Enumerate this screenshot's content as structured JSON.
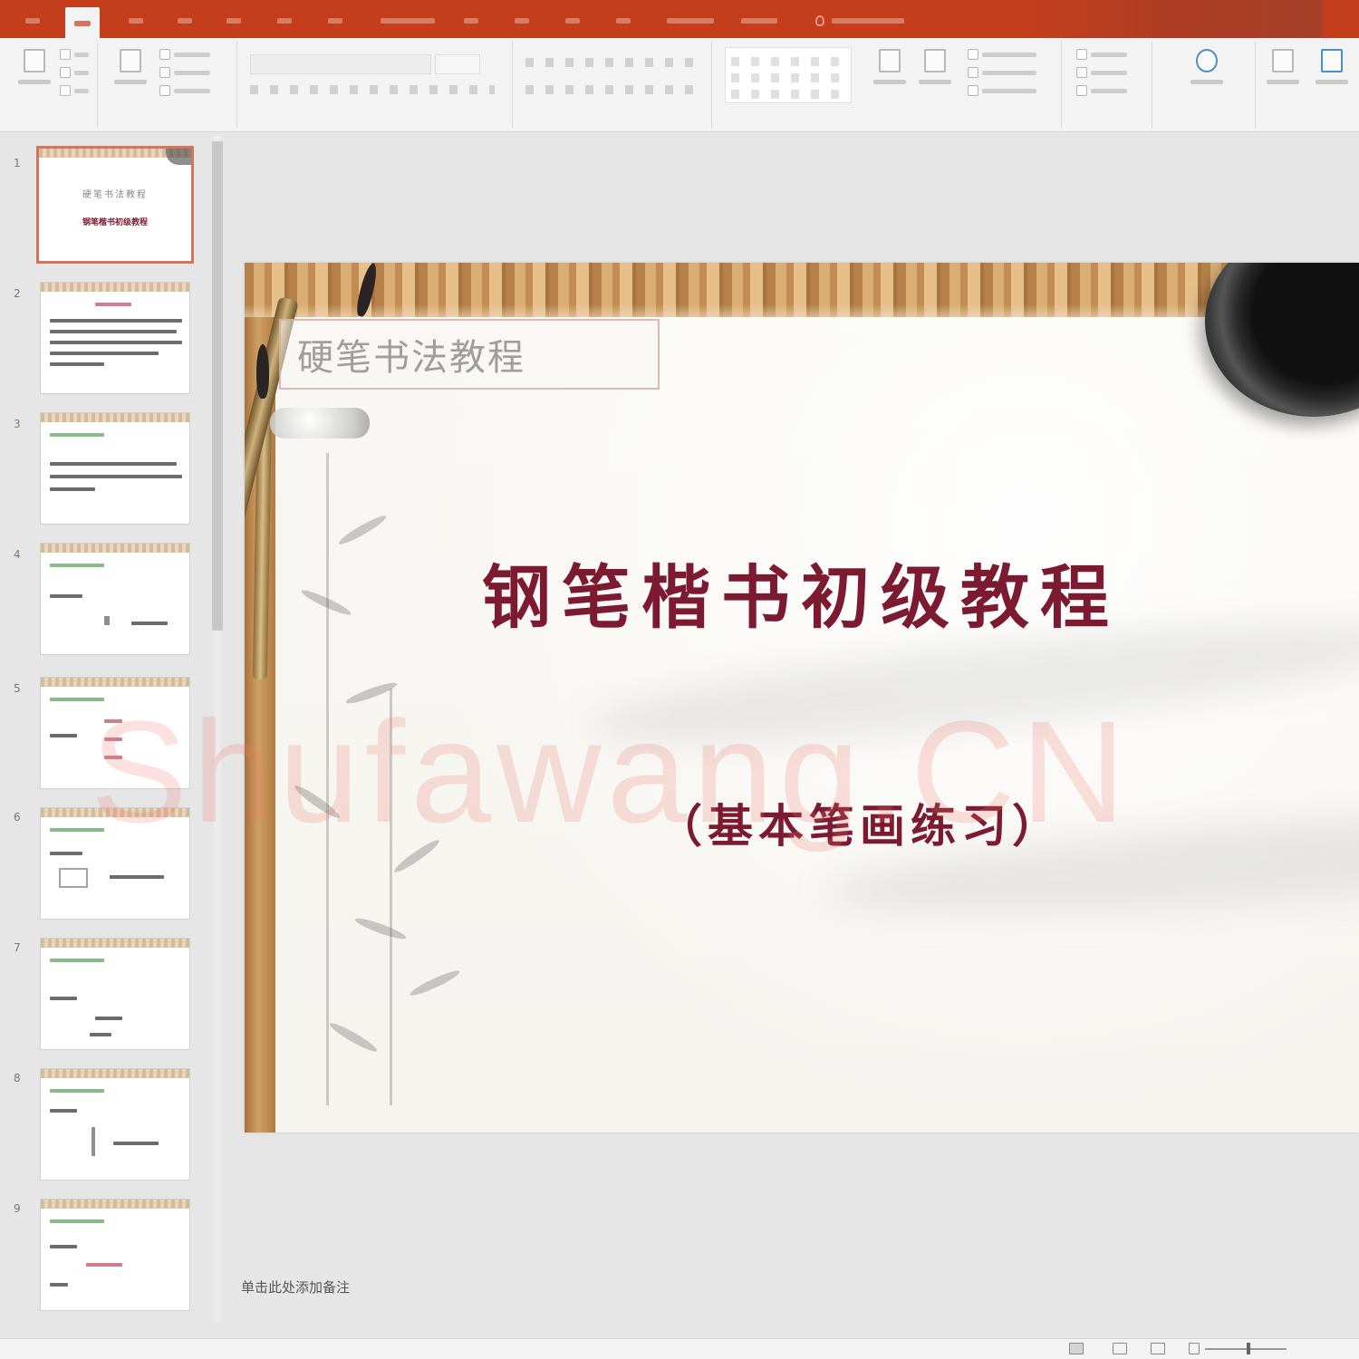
{
  "app": {
    "name": "PowerPoint",
    "accent_color": "#c43e1c"
  },
  "ribbon_tabs": [
    {
      "label": "",
      "active": false
    },
    {
      "label": "",
      "active": true
    },
    {
      "label": "",
      "active": false
    },
    {
      "label": "",
      "active": false
    },
    {
      "label": "",
      "active": false
    },
    {
      "label": "",
      "active": false
    },
    {
      "label": "",
      "active": false
    },
    {
      "label": "",
      "active": false
    },
    {
      "label": "",
      "active": false
    },
    {
      "label": "",
      "active": false
    },
    {
      "label": "",
      "active": false
    },
    {
      "label": "",
      "active": false
    },
    {
      "label": "",
      "active": false
    },
    {
      "label": "",
      "active": false
    }
  ],
  "tell_me": {
    "icon": "lightbulb-icon",
    "label": ""
  },
  "ribbon_groups": [
    {
      "id": "clipboard",
      "label": ""
    },
    {
      "id": "slides",
      "label": ""
    },
    {
      "id": "font",
      "label": ""
    },
    {
      "id": "paragraph",
      "label": ""
    },
    {
      "id": "drawing",
      "label": ""
    },
    {
      "id": "editing",
      "label": ""
    },
    {
      "id": "voice",
      "label": ""
    },
    {
      "id": "designer",
      "label": ""
    }
  ],
  "thumbnails": [
    {
      "number": "1",
      "selected": true,
      "title": "硬笔书法教程",
      "subtitle": "钢笔楷书初级教程"
    },
    {
      "number": "2",
      "selected": false
    },
    {
      "number": "3",
      "selected": false
    },
    {
      "number": "4",
      "selected": false
    },
    {
      "number": "5",
      "selected": false
    },
    {
      "number": "6",
      "selected": false
    },
    {
      "number": "7",
      "selected": false
    },
    {
      "number": "8",
      "selected": false
    },
    {
      "number": "9",
      "selected": false
    }
  ],
  "slide": {
    "top_label": "硬笔书法教程",
    "title": "钢笔楷书初级教程",
    "subtitle": "（基本笔画练习）",
    "title_color": "#7b1a30"
  },
  "watermark": "Shufawang.CN",
  "notes_hint": "单击此处添加备注",
  "status": {
    "slide_info": "",
    "language": "",
    "notes_label": "",
    "comments_label": ""
  }
}
